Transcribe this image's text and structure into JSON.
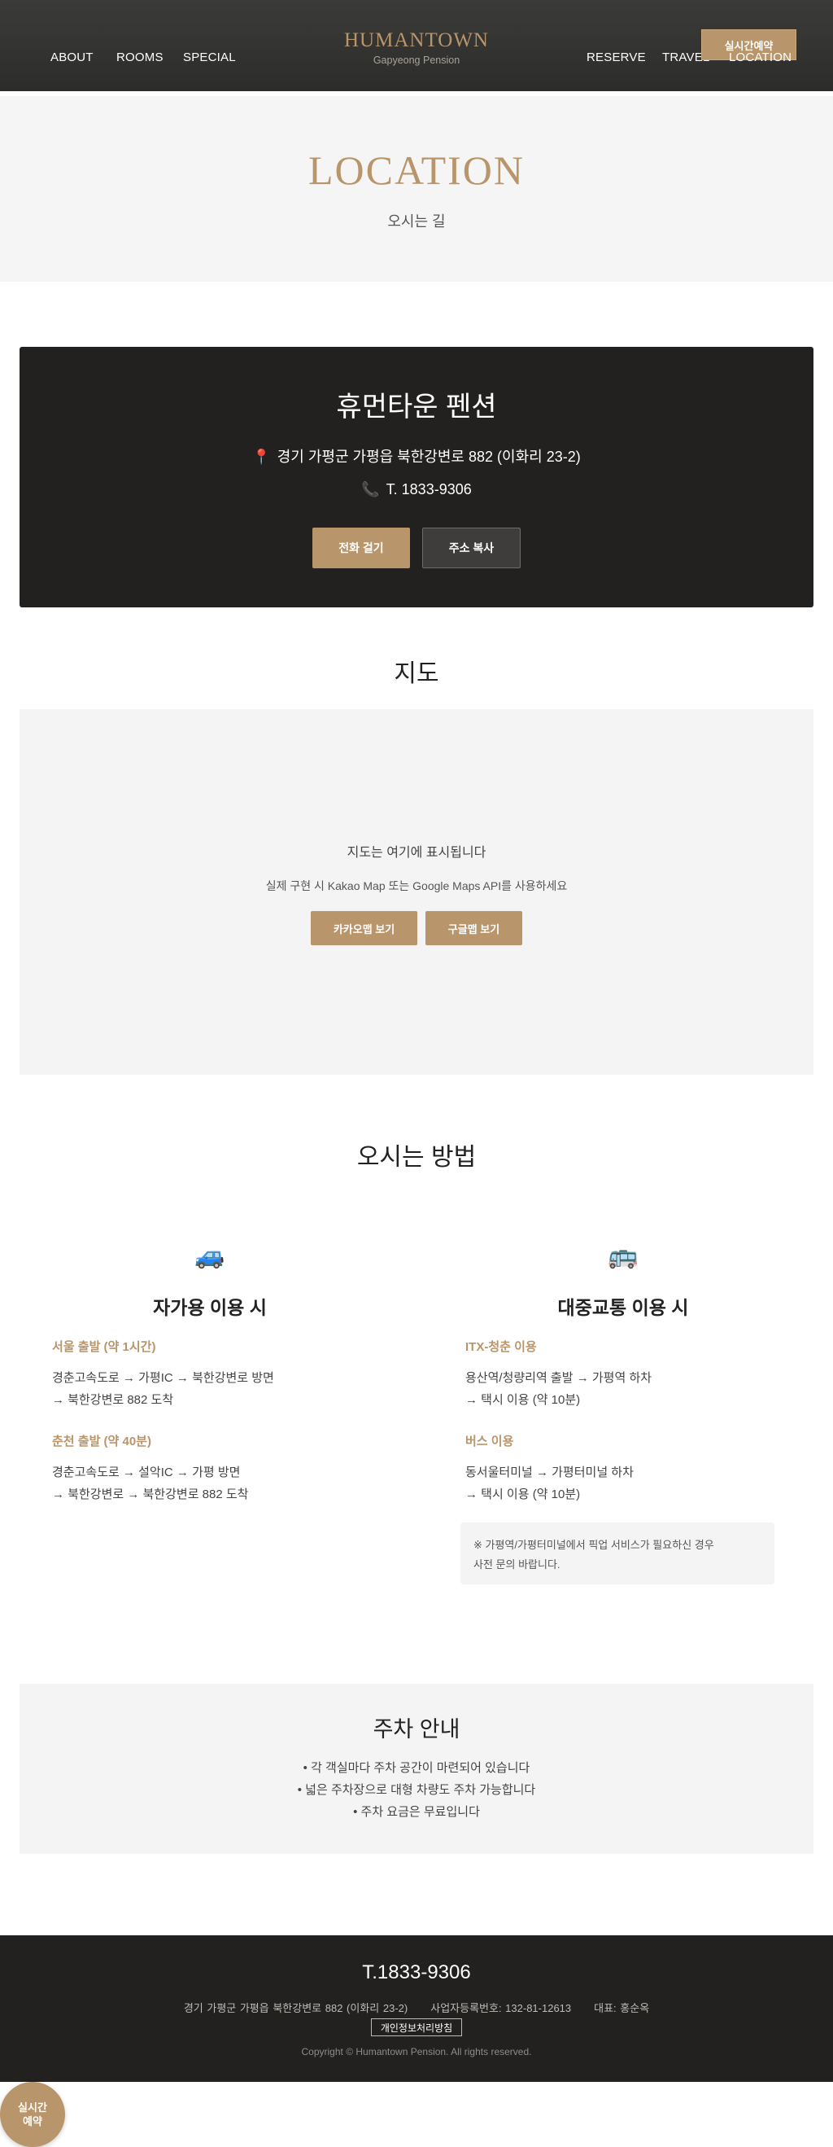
{
  "header": {
    "nav_left": [
      "ABOUT",
      "ROOMS",
      "SPECIAL"
    ],
    "nav_right": [
      "RESERVE",
      "TRAVEL",
      "LOCATION"
    ],
    "brand": "HUMANTOWN",
    "brand_sub": "Gapyeong Pension",
    "reserve_button": "실시간예약"
  },
  "hero": {
    "title": "LOCATION",
    "subtitle": "오시는 길"
  },
  "info": {
    "name": "휴먼타운 펜션",
    "address": "경기 가평군 가평읍 북한강변로 882 (이화리 23-2)",
    "phone": "T. 1833-9306",
    "call_button": "전화 걸기",
    "copy_button": "주소 복사",
    "pin_icon": "📍",
    "phone_icon": "📞"
  },
  "map": {
    "title": "지도",
    "placeholder": "지도는 여기에 표시됩니다",
    "note": "실제 구현 시 Kakao Map 또는 Google Maps API를 사용하세요",
    "kakao_button": "카카오맵 보기",
    "google_button": "구글맵 보기"
  },
  "directions": {
    "title": "오시는 방법",
    "car": {
      "icon": "🚙",
      "title": "자가용 이용 시",
      "routes": [
        {
          "head": "서울 출발 (약 1시간)",
          "line1": "경춘고속도로 → 가평IC → 북한강변로 방면",
          "line2": "→ 북한강변로 882 도착"
        },
        {
          "head": "춘천 출발 (약 40분)",
          "line1": "경춘고속도로 → 설악IC → 가평 방면",
          "line2": "→ 북한강변로 → 북한강변로 882 도착"
        }
      ]
    },
    "transit": {
      "icon": "🚌",
      "title": "대중교통 이용 시",
      "routes": [
        {
          "head": "ITX-청춘 이용",
          "line1": "용산역/청량리역 출발 → 가평역 하차",
          "line2": "→ 택시 이용 (약 10분)"
        },
        {
          "head": "버스 이용",
          "line1": "동서울터미널 → 가평터미널 하차",
          "line2": "→ 택시 이용 (약 10분)"
        }
      ],
      "note_line1": "※ 가평역/가평터미널에서 픽업 서비스가 필요하신 경우",
      "note_line2": "사전 문의 바랍니다."
    }
  },
  "parking": {
    "title": "주차 안내",
    "items": [
      "• 각 객실마다 주차 공간이 마련되어 있습니다",
      "• 넓은 주차장으로 대형 차량도 주차 가능합니다",
      "• 주차 요금은 무료입니다"
    ]
  },
  "footer": {
    "phone": "T.1833-9306",
    "address": "경기 가평군 가평읍 북한강변로 882 (이화리 23-2)",
    "business_no": "사업자등록번호: 132-81-12613",
    "ceo": "대표: 홍순옥",
    "privacy": "개인정보처리방침",
    "copyright": "Copyright © Humantown Pension. All rights reserved."
  },
  "float_button": {
    "line1": "실시간",
    "line2": "예약"
  },
  "colors": {
    "accent": "#b8956a",
    "dark": "#222120",
    "light_bg": "#f4f4f4"
  }
}
